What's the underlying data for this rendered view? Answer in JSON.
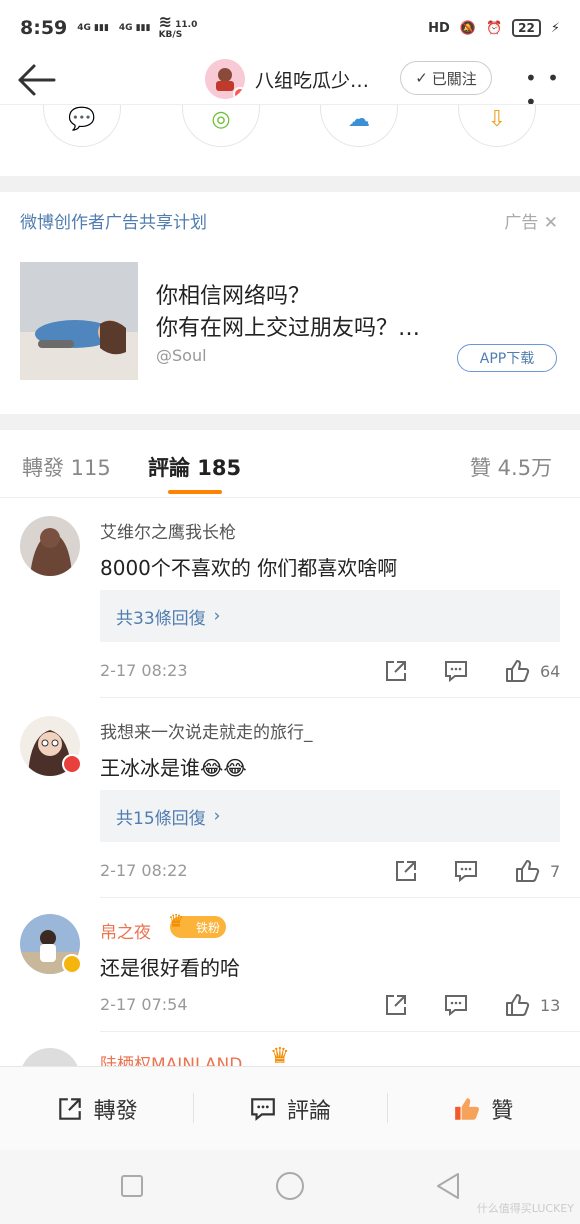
{
  "status_bar": {
    "time": "8:59",
    "net_label_1": "4G",
    "net_label_2": "4G",
    "speed": "11.0",
    "speed_unit": "KB/S",
    "battery": "22"
  },
  "nav": {
    "title": "八组吃瓜少…",
    "follow_label": "已關注"
  },
  "ad": {
    "header": "微博创作者广告共享计划",
    "tag": "广告",
    "line1": "你相信网络吗？",
    "line2": "你有在网上交过朋友吗？…",
    "source": "@Soul",
    "button": "APP下载"
  },
  "tabs": {
    "repost": "轉發 115",
    "comment": "評論 185",
    "like": "贊 4.5万"
  },
  "comments": [
    {
      "name": "艾维尔之鹰我长枪",
      "text": "8000个不喜欢的 你们都喜欢啥啊",
      "replies": "共33條回復",
      "time": "2-17 08:23",
      "likes": "64"
    },
    {
      "name": "我想来一次说走就走的旅行_",
      "text": "王冰冰是谁",
      "replies": "共15條回復",
      "time": "2-17 08:22",
      "likes": "7"
    },
    {
      "name": "帛之夜",
      "fan_badge": "铁粉",
      "text": "还是很好看的哈",
      "time": "2-17 07:54",
      "likes": "13"
    },
    {
      "name": "陆栖权MAINLAND"
    }
  ],
  "actionbar": {
    "repost": "轉發",
    "comment": "評論",
    "like": "贊"
  },
  "watermark": "什么值得买LUCKEY",
  "colors": {
    "accent_orange": "#ff8200",
    "link_blue": "#507daf",
    "vip_name": "#eb7350",
    "like_active": "#f25a29"
  }
}
